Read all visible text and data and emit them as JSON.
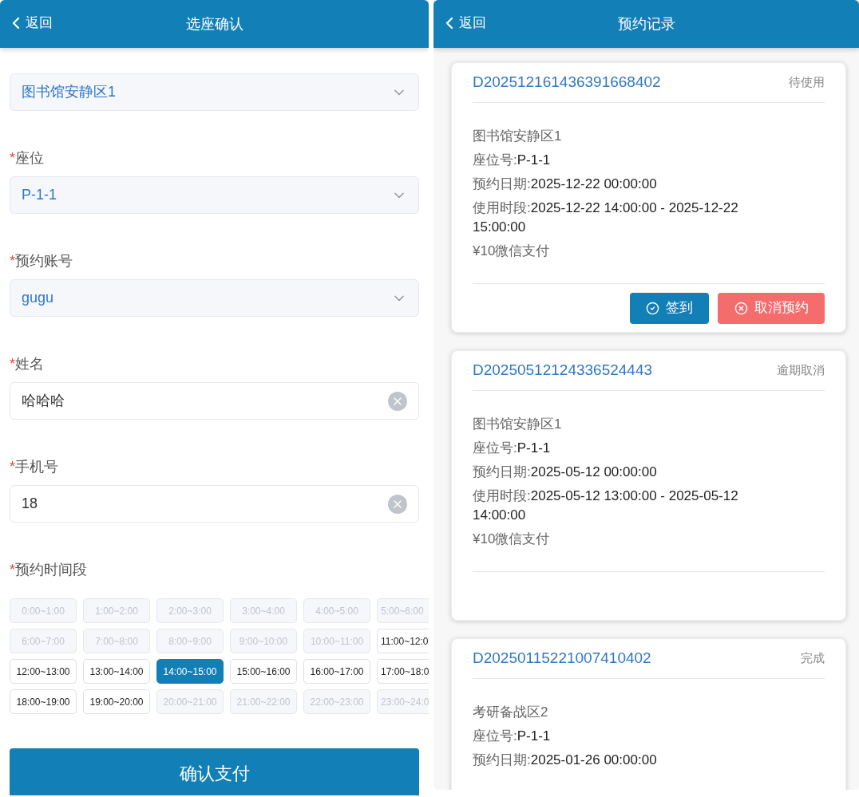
{
  "left": {
    "header": {
      "back": "返回",
      "title": "选座确认"
    },
    "fields": [
      {
        "kind": "select",
        "value": "图书馆安静区1"
      },
      {
        "marker": "*",
        "label": "座位",
        "kind": "select",
        "value": "P-1-1"
      },
      {
        "marker": "*",
        "label": "预约账号",
        "kind": "select",
        "value": "gugu"
      },
      {
        "marker": "*",
        "label": "姓名",
        "kind": "input",
        "value": "哈哈哈",
        "clearable": true
      },
      {
        "marker": "*",
        "label": "手机号",
        "kind": "input",
        "value": "18",
        "clearable": true
      }
    ],
    "slots_label": {
      "marker": "*",
      "label": "预约时间段"
    },
    "slots": [
      {
        "text": "0:00~1:00",
        "disabled": true,
        "selected": false
      },
      {
        "text": "1:00~2:00",
        "disabled": true,
        "selected": false
      },
      {
        "text": "2:00~3:00",
        "disabled": true,
        "selected": false
      },
      {
        "text": "3:00~4:00",
        "disabled": true,
        "selected": false
      },
      {
        "text": "4:00~5:00",
        "disabled": true,
        "selected": false
      },
      {
        "text": "5:00~6:00",
        "disabled": true,
        "selected": false
      },
      {
        "text": "6:00~7:00",
        "disabled": true,
        "selected": false
      },
      {
        "text": "7:00~8:00",
        "disabled": true,
        "selected": false
      },
      {
        "text": "8:00~9:00",
        "disabled": true,
        "selected": false
      },
      {
        "text": "9:00~10:00",
        "disabled": true,
        "selected": false
      },
      {
        "text": "10:00~11:00",
        "disabled": true,
        "selected": false
      },
      {
        "text": "11:00~12:0",
        "disabled": false,
        "selected": false
      },
      {
        "text": "12:00~13:00",
        "disabled": false,
        "selected": false
      },
      {
        "text": "13:00~14:00",
        "disabled": false,
        "selected": false
      },
      {
        "text": "14:00~15:00",
        "disabled": false,
        "selected": true
      },
      {
        "text": "15:00~16:00",
        "disabled": false,
        "selected": false
      },
      {
        "text": "16:00~17:00",
        "disabled": false,
        "selected": false
      },
      {
        "text": "17:00~18:0",
        "disabled": false,
        "selected": false
      },
      {
        "text": "18:00~19:00",
        "disabled": false,
        "selected": false
      },
      {
        "text": "19:00~20:00",
        "disabled": false,
        "selected": false
      },
      {
        "text": "20:00~21:00",
        "disabled": true,
        "selected": false
      },
      {
        "text": "21:00~22:00",
        "disabled": true,
        "selected": false
      },
      {
        "text": "22:00~23:00",
        "disabled": true,
        "selected": false
      },
      {
        "text": "23:00~24:0",
        "disabled": true,
        "selected": false
      }
    ],
    "submit": "确认支付"
  },
  "right": {
    "header": {
      "back": "返回",
      "title": "预约记录"
    },
    "records": [
      {
        "order": "D202512161436391668402",
        "status": "待使用",
        "lines": [
          {
            "label": "图书馆安静区1"
          },
          {
            "label": "座位号:",
            "value": "P-1-1"
          },
          {
            "label": "预约日期:",
            "value": "2025-12-22 00:00:00"
          },
          {
            "label": "使用时段:",
            "value": "2025-12-22 14:00:00 - 2025-12-22 15:00:00"
          },
          {
            "label": "¥10微信支付"
          }
        ],
        "actions": [
          {
            "kind": "checkin",
            "text": "签到"
          },
          {
            "kind": "cancel",
            "text": "取消预约"
          }
        ]
      },
      {
        "order": "D20250512124336524443",
        "status": "逾期取消",
        "lines": [
          {
            "label": "图书馆安静区1"
          },
          {
            "label": "座位号:",
            "value": "P-1-1"
          },
          {
            "label": "预约日期:",
            "value": "2025-05-12 00:00:00"
          },
          {
            "label": "使用时段:",
            "value": "2025-05-12 13:00:00 - 2025-05-12 14:00:00"
          },
          {
            "label": "¥10微信支付"
          }
        ]
      },
      {
        "order": "D20250115221007410402",
        "status": "完成",
        "lines": [
          {
            "label": "考研备战区2"
          },
          {
            "label": "座位号:",
            "value": "P-1-1"
          },
          {
            "label": "预约日期:",
            "value": "2025-01-26 00:00:00"
          }
        ]
      }
    ]
  }
}
